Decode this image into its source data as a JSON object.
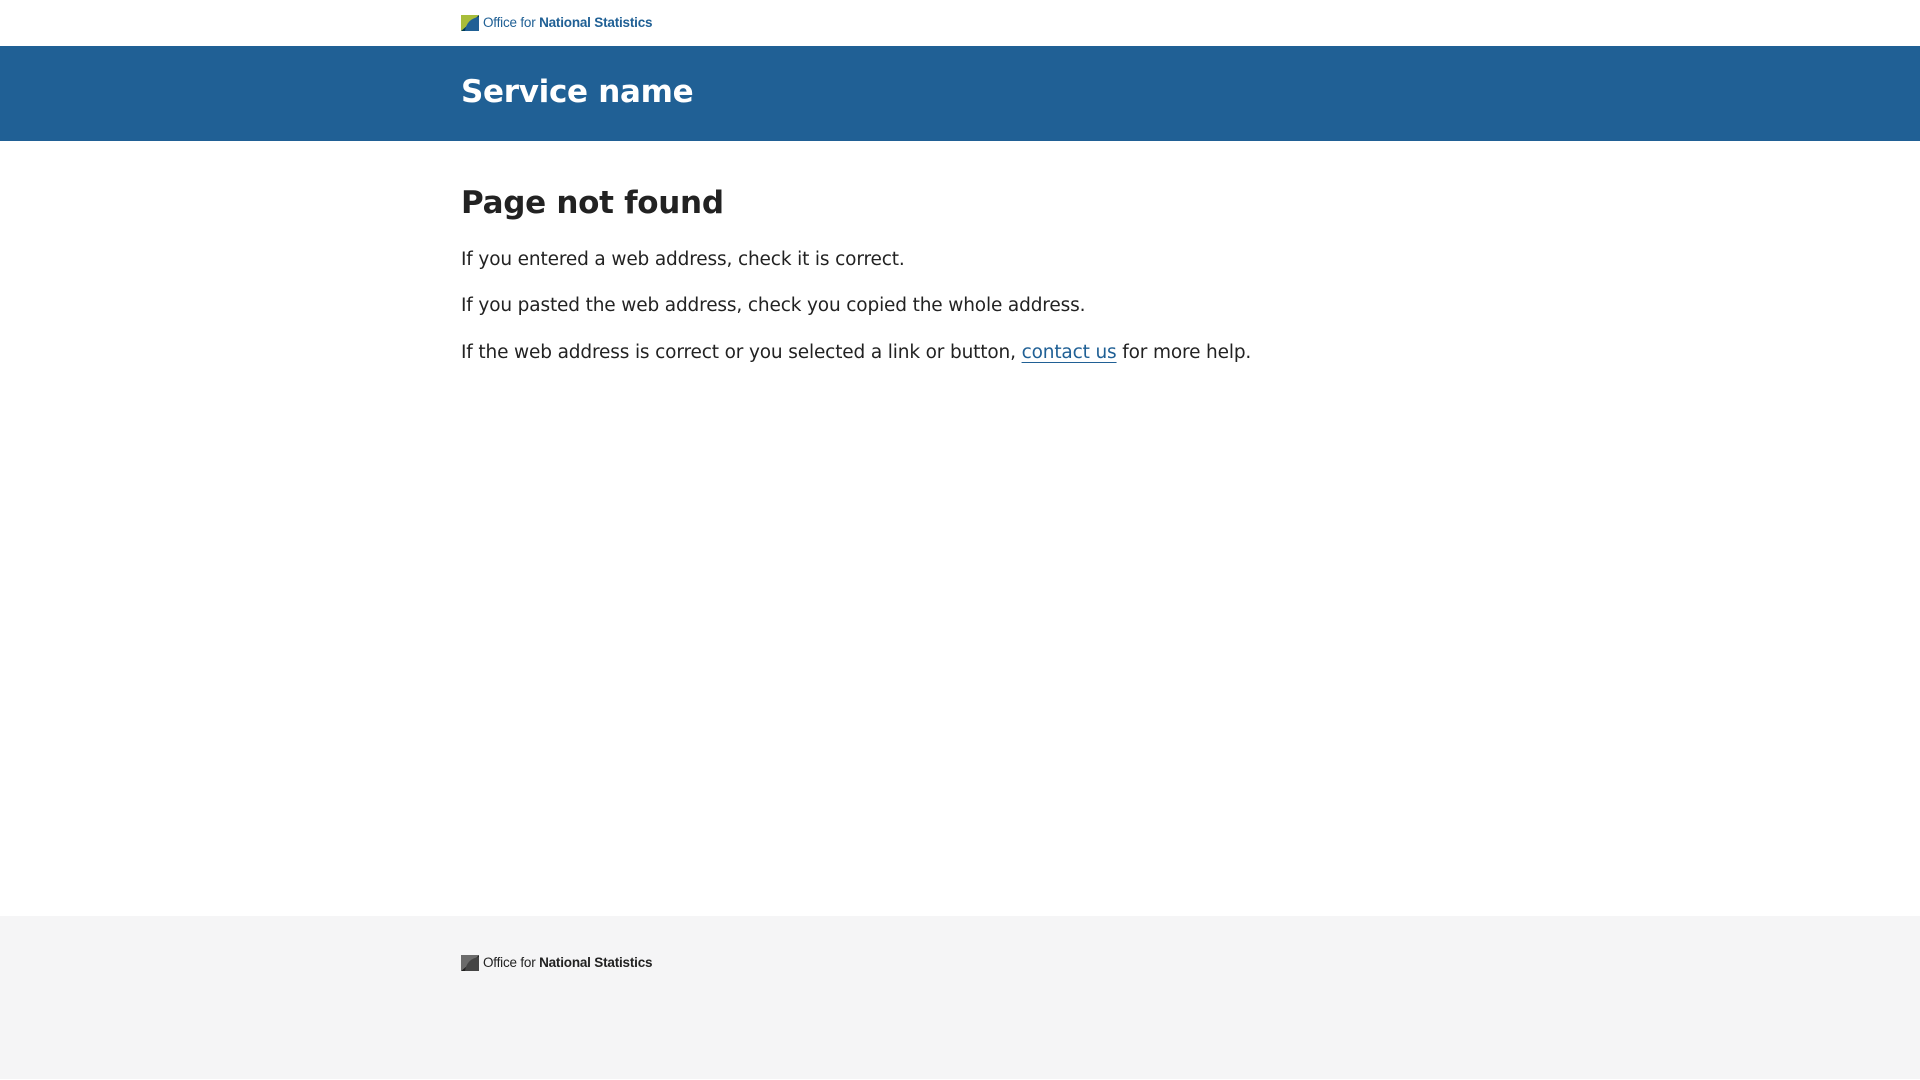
{
  "header": {
    "logo": {
      "icon": "ons-logo-icon",
      "text_light": "Office for ",
      "text_bold": "National Statistics"
    },
    "service_name": "Service name"
  },
  "main": {
    "title": "Page not found",
    "paragraphs": {
      "p1": "If you entered a web address, check it is correct.",
      "p2": "If you pasted the web address, check you copied the whole address.",
      "p3_before": "If the web address is correct or you selected a link or button, ",
      "p3_link": "contact us",
      "p3_after": " for more help."
    }
  },
  "footer": {
    "logo": {
      "icon": "ons-logo-icon",
      "text_light": "Office for ",
      "text_bold": "National Statistics"
    }
  },
  "colors": {
    "brand_blue": "#206095",
    "logo_green": "#a8bd3a",
    "logo_dark": "#003c57",
    "footer_bg": "#f5f5f6",
    "text": "#222222"
  }
}
